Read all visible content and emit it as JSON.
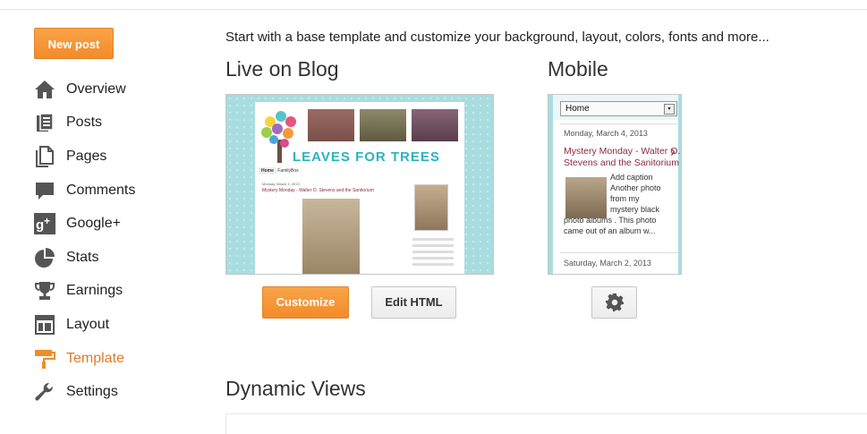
{
  "sidebar": {
    "new_post_label": "New post",
    "items": [
      {
        "label": "Overview",
        "icon": "home-icon"
      },
      {
        "label": "Posts",
        "icon": "posts-icon"
      },
      {
        "label": "Pages",
        "icon": "pages-icon"
      },
      {
        "label": "Comments",
        "icon": "comment-icon"
      },
      {
        "label": "Google+",
        "icon": "google-plus-icon"
      },
      {
        "label": "Stats",
        "icon": "pie-chart-icon"
      },
      {
        "label": "Earnings",
        "icon": "trophy-icon"
      },
      {
        "label": "Layout",
        "icon": "layout-icon"
      },
      {
        "label": "Template",
        "icon": "paint-roller-icon",
        "active": true
      },
      {
        "label": "Settings",
        "icon": "wrench-icon"
      }
    ],
    "active_color": "#dd7a2b",
    "icon_color": "#555555"
  },
  "main": {
    "intro": "Start with a base template and customize your background, layout, colors, fonts and more...",
    "live_heading": "Live on Blog",
    "mobile_heading": "Mobile",
    "dynamic_heading": "Dynamic Views",
    "customize_label": "Customize",
    "edit_html_label": "Edit HTML",
    "accent": "#f28b2a"
  },
  "blog_preview": {
    "title": "LEAVES FOR TREES",
    "nav_home": "Home",
    "nav_other": "FamilyBox",
    "post_date": "Monday, March 4, 2013",
    "post_title": "Mystery Monday - Walter O. Stevens and the Sanitorium"
  },
  "mobile_preview": {
    "select_value": "Home",
    "date1": "Monday, March 4, 2013",
    "post_title": "Mystery Monday - Walter O. Stevens and the Sanitorium",
    "excerpt": "Add caption Another photo from my mystery black photo albums . This photo came out of an album w...",
    "date2": "Saturday, March 2, 2013"
  }
}
